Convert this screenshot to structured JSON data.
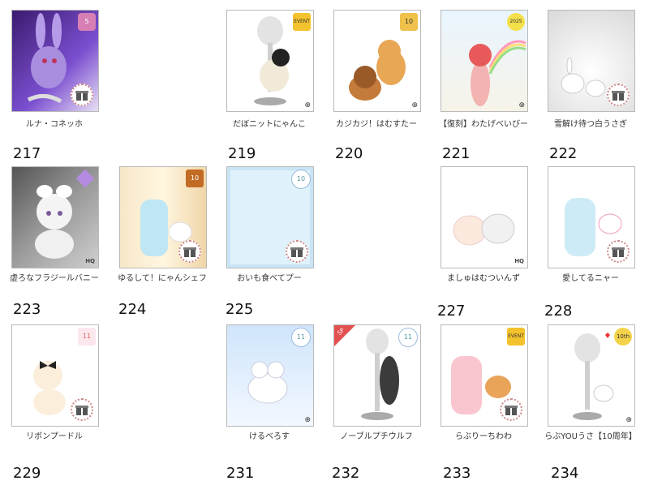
{
  "items": [
    {
      "name": "ルナ・コネッホ",
      "num": "217"
    },
    {
      "name": "だぼニットにゃんこ",
      "num": "219"
    },
    {
      "name": "カジカジ！はむすたー",
      "num": "220"
    },
    {
      "name": "【復刻】わたげべいびー",
      "num": "221"
    },
    {
      "name": "雪解け待つ白うさぎ",
      "num": "222"
    },
    {
      "name": "虚ろなフラジールバニー",
      "num": "223"
    },
    {
      "name": "ゆるして！にゃんシェフ",
      "num": "224"
    },
    {
      "name": "おいも食べてプー",
      "num": "225"
    },
    {
      "name": "ましゅはむついんず",
      "num": "227"
    },
    {
      "name": "愛してるニャー",
      "num": "228"
    },
    {
      "name": "リボンプードル",
      "num": "229"
    },
    {
      "name": "けるべろす",
      "num": "231"
    },
    {
      "name": "ノーブルプチウルフ",
      "num": "232"
    },
    {
      "name": "らぶりーちわわ",
      "num": "233"
    },
    {
      "name": "らぶYOUうさ【10周年】",
      "num": "234"
    }
  ],
  "badges": {
    "b5": "5",
    "b10": "10",
    "b2025": "2025",
    "b10th": "10th",
    "sp": "SP",
    "hq": "HQ",
    "event": "EVENT"
  }
}
